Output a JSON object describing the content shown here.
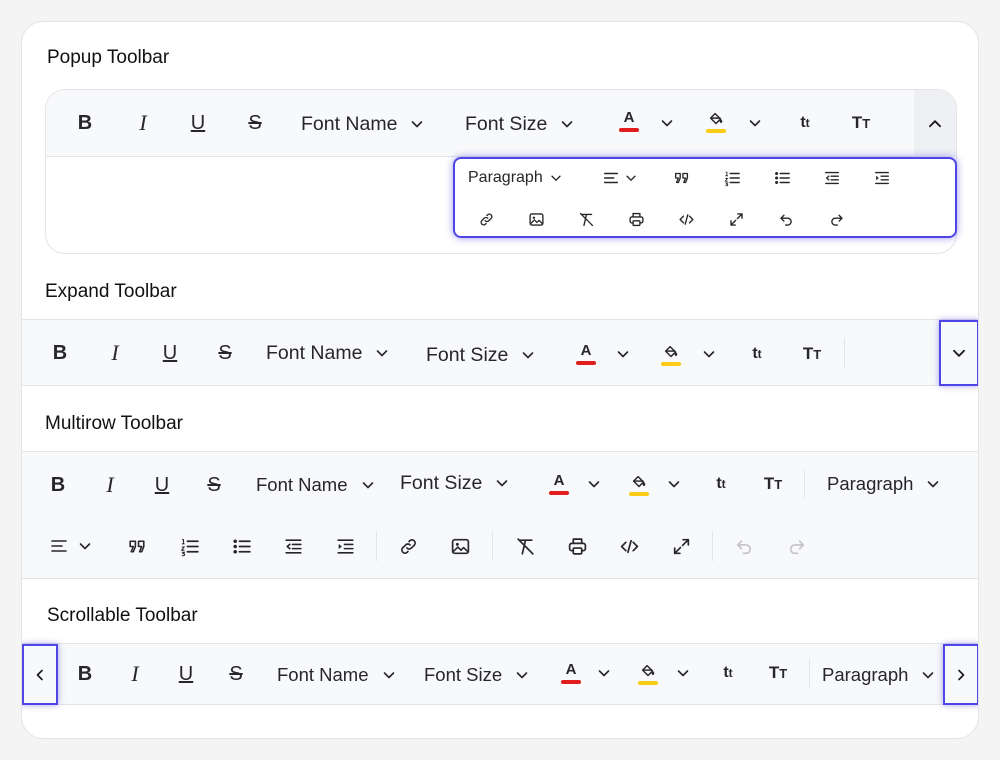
{
  "sections": {
    "popup": {
      "title": "Popup Toolbar",
      "font_name": "Font Name",
      "font_size": "Font Size",
      "popup_paragraph": "Paragraph"
    },
    "expand": {
      "title": "Expand Toolbar",
      "font_name": "Font Name",
      "font_size": "Font Size"
    },
    "multirow": {
      "title": "Multirow Toolbar",
      "font_name": "Font Name",
      "font_size": "Font Size",
      "paragraph": "Paragraph"
    },
    "scrollable": {
      "title": "Scrollable Toolbar",
      "font_name": "Font Name",
      "font_size": "Font Size",
      "paragraph": "Paragraph"
    }
  },
  "glyphs": {
    "bold": "B",
    "italic": "I",
    "underline": "U",
    "strike": "S",
    "lowercase": "tt",
    "uppercase": "TT",
    "font_color": "A"
  },
  "colors": {
    "font_color_bar": "#e11d1d",
    "highlight_bar": "#facc15",
    "focus_outline": "#4f46e5",
    "toolbar_bg": "#f8f9fb"
  }
}
